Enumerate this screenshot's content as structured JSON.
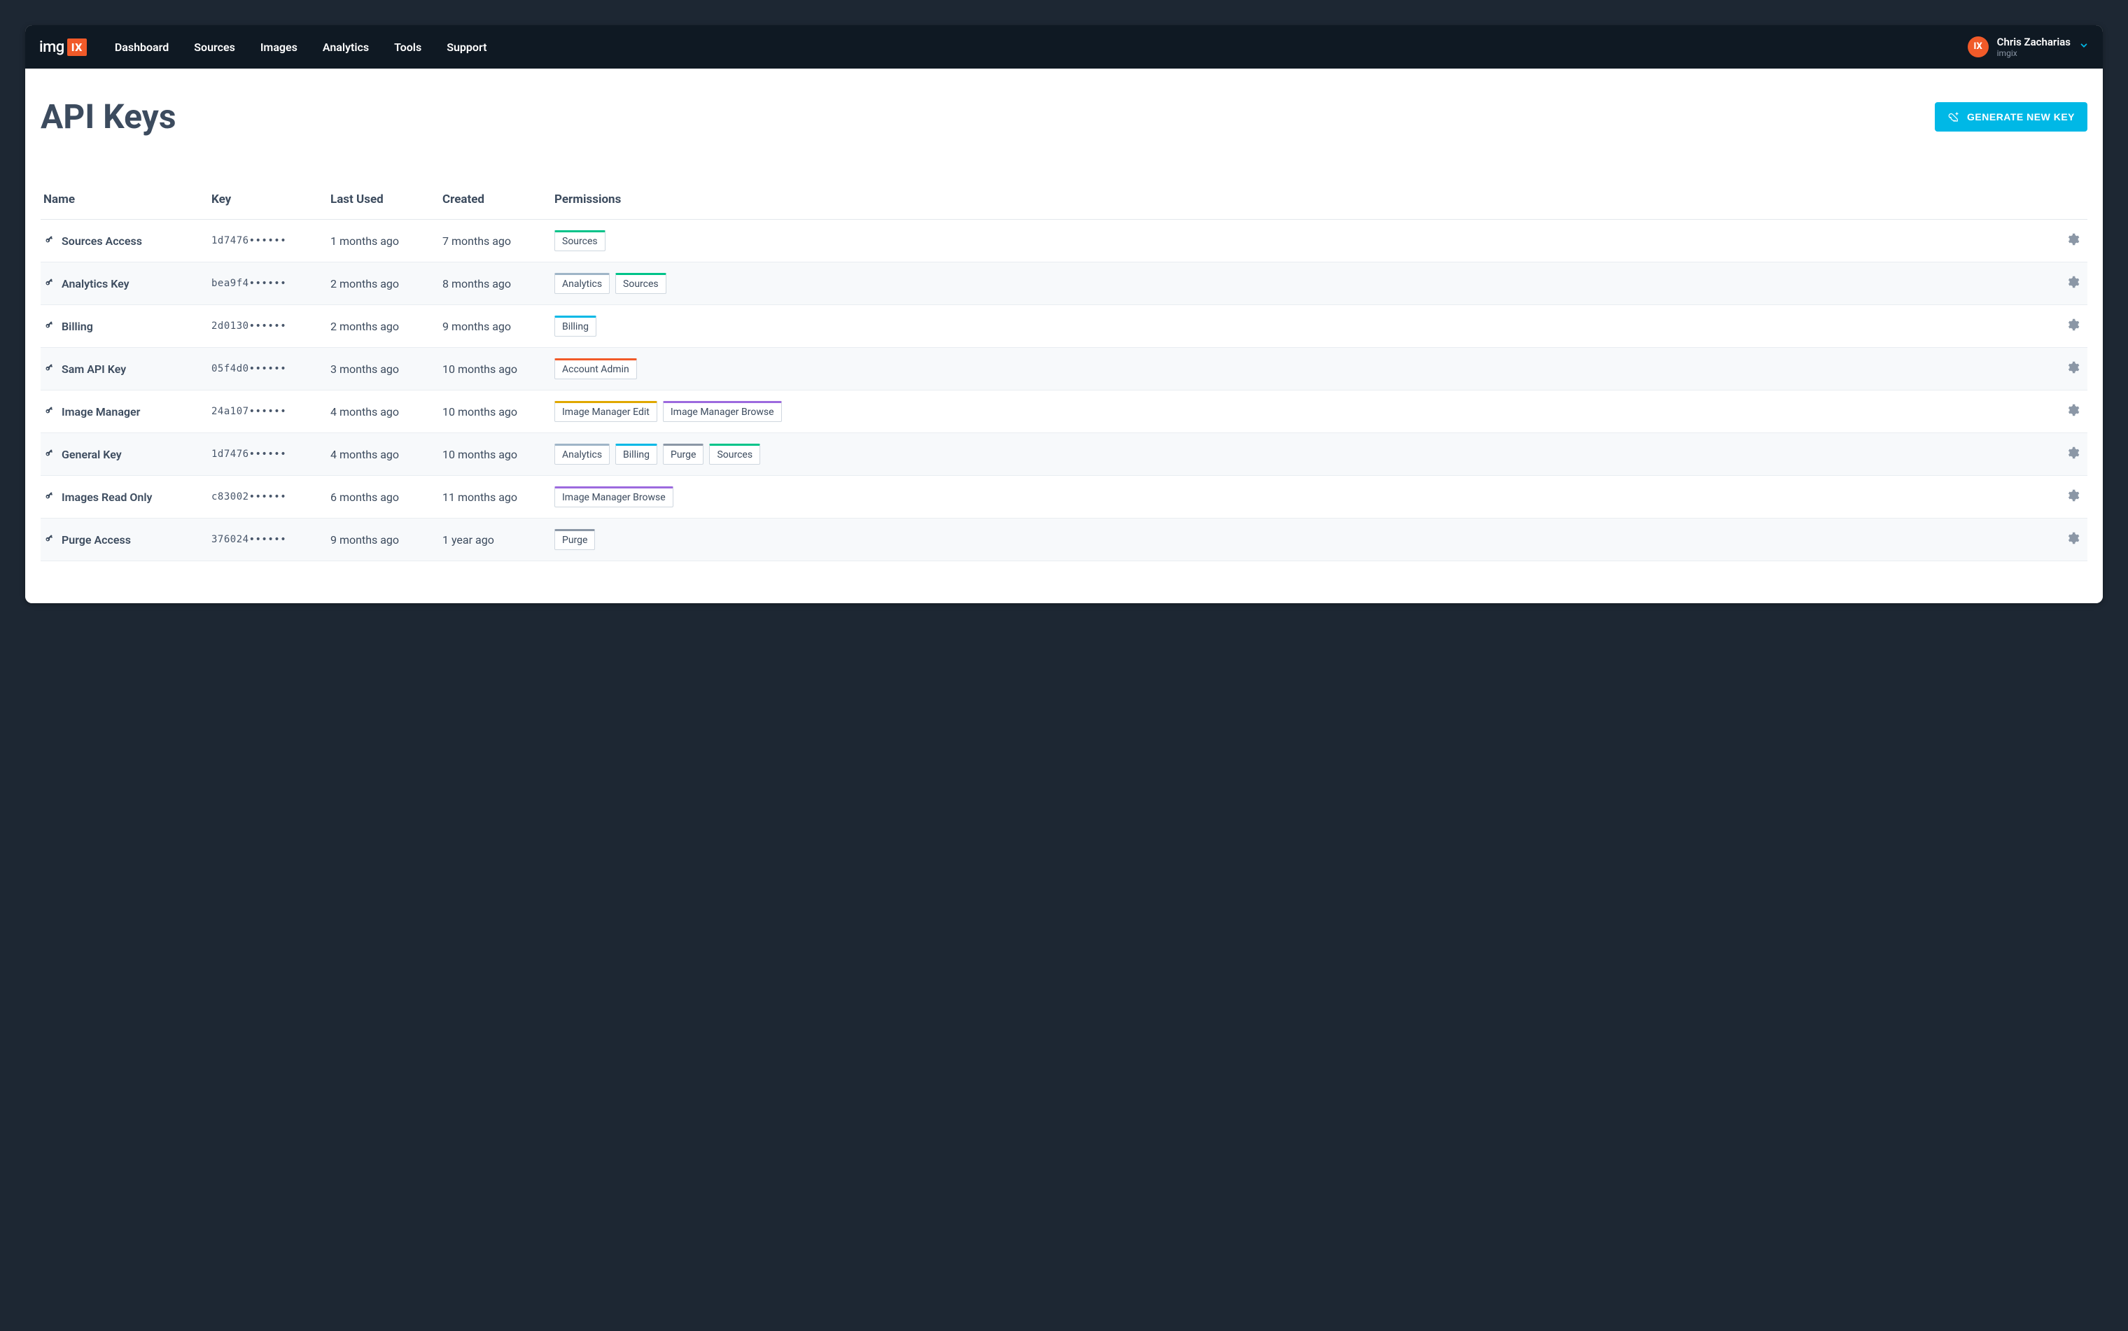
{
  "brand": {
    "name": "img",
    "badge": "IX"
  },
  "nav": [
    "Dashboard",
    "Sources",
    "Images",
    "Analytics",
    "Tools",
    "Support"
  ],
  "user": {
    "name": "Chris Zacharias",
    "org": "imgix",
    "avatar": "IX"
  },
  "page": {
    "title": "API Keys",
    "generate_label": "GENERATE NEW KEY"
  },
  "columns": [
    "Name",
    "Key",
    "Last Used",
    "Created",
    "Permissions"
  ],
  "permission_colors": {
    "Sources": "c-sources",
    "Analytics": "c-analytics",
    "Billing": "c-billing",
    "Account Admin": "c-admin",
    "Image Manager Edit": "c-imedit",
    "Image Manager Browse": "c-ibrowse",
    "Purge": "c-purge"
  },
  "rows": [
    {
      "name": "Sources Access",
      "key": "1d7476••••••",
      "last_used": "1 months ago",
      "created": "7 months ago",
      "permissions": [
        "Sources"
      ]
    },
    {
      "name": "Analytics Key",
      "key": "bea9f4••••••",
      "last_used": "2 months ago",
      "created": "8 months ago",
      "permissions": [
        "Analytics",
        "Sources"
      ]
    },
    {
      "name": "Billing",
      "key": "2d0130••••••",
      "last_used": "2 months ago",
      "created": "9 months ago",
      "permissions": [
        "Billing"
      ]
    },
    {
      "name": "Sam API Key",
      "key": "05f4d0••••••",
      "last_used": "3 months ago",
      "created": "10 months ago",
      "permissions": [
        "Account Admin"
      ]
    },
    {
      "name": "Image Manager",
      "key": "24a107••••••",
      "last_used": "4 months ago",
      "created": "10 months ago",
      "permissions": [
        "Image Manager Edit",
        "Image Manager Browse"
      ]
    },
    {
      "name": "General Key",
      "key": "1d7476••••••",
      "last_used": "4 months ago",
      "created": "10 months ago",
      "permissions": [
        "Analytics",
        "Billing",
        "Purge",
        "Sources"
      ]
    },
    {
      "name": "Images Read Only",
      "key": "c83002••••••",
      "last_used": "6 months ago",
      "created": "11 months ago",
      "permissions": [
        "Image Manager Browse"
      ]
    },
    {
      "name": "Purge Access",
      "key": "376024••••••",
      "last_used": "9 months ago",
      "created": "1 year ago",
      "permissions": [
        "Purge"
      ]
    }
  ]
}
